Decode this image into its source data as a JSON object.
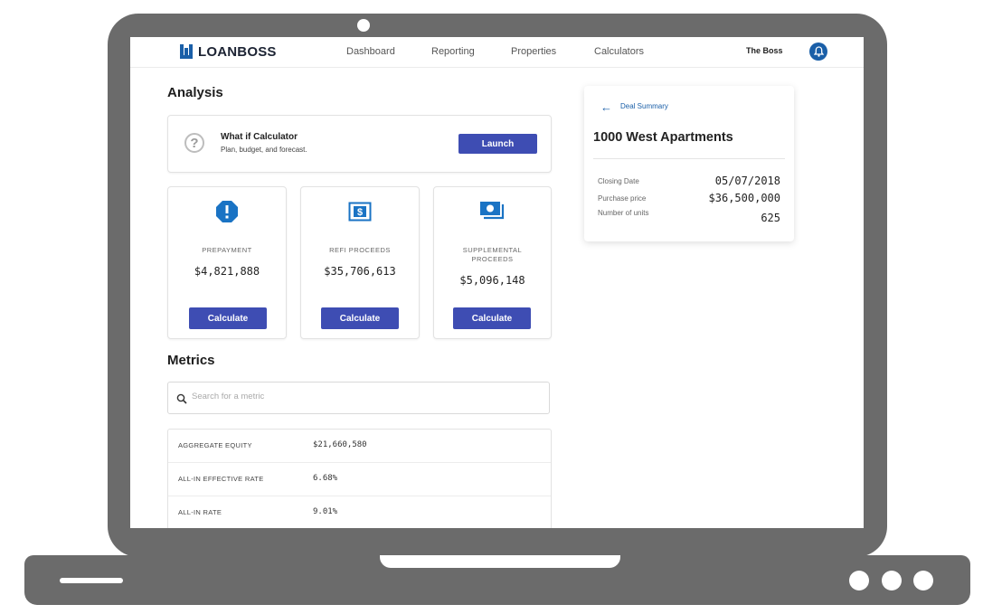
{
  "nav": {
    "logo": "LOANBOSS",
    "links": [
      "Dashboard",
      "Reporting",
      "Properties",
      "Calculators"
    ],
    "user": "The Boss"
  },
  "analysis": {
    "heading": "Analysis",
    "what_if": {
      "title": "What if Calculator",
      "subtitle": "Plan, budget, and forecast.",
      "button": "Launch"
    },
    "calculators": [
      {
        "label": "PREPAYMENT",
        "value": "$4,821,888",
        "button": "Calculate",
        "icon": "alert-octagon-icon"
      },
      {
        "label": "REFI PROCEEDS",
        "value": "$35,706,613",
        "button": "Calculate",
        "icon": "dollar-bill-icon"
      },
      {
        "label": "SUPPLEMENTAL PROCEEDS",
        "value": "$5,096,148",
        "button": "Calculate",
        "icon": "cash-stack-icon"
      }
    ]
  },
  "metrics": {
    "heading": "Metrics",
    "search_placeholder": "Search for a metric",
    "rows": [
      {
        "name": "AGGREGATE EQUITY",
        "value": "$21,660,580"
      },
      {
        "name": "ALL-IN EFFECTIVE RATE",
        "value": "6.68%"
      },
      {
        "name": "ALL-IN RATE",
        "value": "9.01%"
      }
    ]
  },
  "deal": {
    "back_label": "Deal Summary",
    "title": "1000 West Apartments",
    "fields": [
      {
        "label": "Closing Date",
        "value": "05/07/2018"
      },
      {
        "label": "Purchase price",
        "value": "$36,500,000"
      },
      {
        "label": "Number of units",
        "value": "625"
      }
    ]
  },
  "colors": {
    "accent": "#3e4db3",
    "brand_blue": "#1a5fa8",
    "frame": "#6b6b6b"
  }
}
